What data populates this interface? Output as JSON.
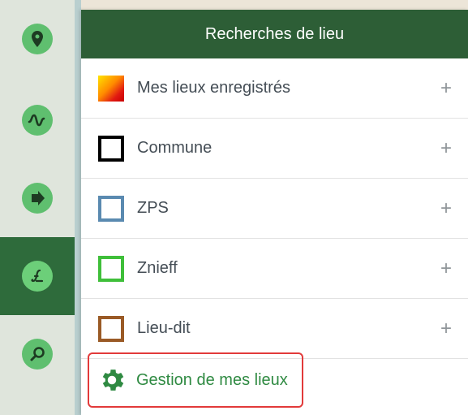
{
  "toolbar": {
    "items": [
      {
        "icon": "location-pin-icon",
        "active": false
      },
      {
        "icon": "wave-icon",
        "active": false
      },
      {
        "icon": "arrow-right-icon",
        "active": false
      },
      {
        "icon": "script-l-icon",
        "active": true
      },
      {
        "icon": "magnifier-icon",
        "active": false
      }
    ]
  },
  "panel": {
    "title": "Recherches de lieu",
    "rows": [
      {
        "label": "Mes lieux enregistrés",
        "swatch": "gradient",
        "color": "#e11a12",
        "plus": "+"
      },
      {
        "label": "Commune",
        "swatch": "border",
        "color": "#000000",
        "plus": "+"
      },
      {
        "label": "ZPS",
        "swatch": "border",
        "color": "#5a8ab0",
        "plus": "+"
      },
      {
        "label": "Znieff",
        "swatch": "border",
        "color": "#3fbf3a",
        "plus": "+"
      },
      {
        "label": "Lieu-dit",
        "swatch": "border",
        "color": "#9a5a26",
        "plus": "+"
      }
    ],
    "manage": {
      "label": "Gestion de mes lieux",
      "icon": "gear-icon"
    }
  },
  "colors": {
    "header": "#2d5e36",
    "active_tool": "#2e6b3b",
    "icon_circle": "#5fbf6f",
    "highlight": "#e23a3a"
  }
}
